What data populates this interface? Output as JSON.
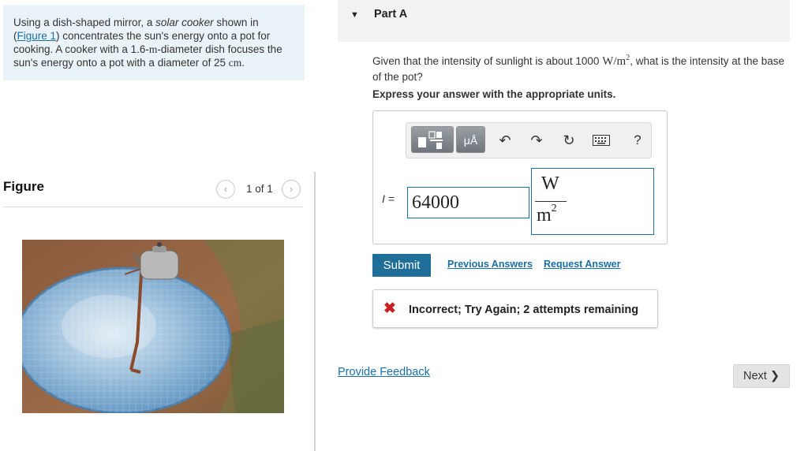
{
  "problem": {
    "text_1": "Using a dish-shaped mirror, a ",
    "italic": "solar cooker",
    "text_2": " shown in (",
    "figure_link": "Figure 1",
    "text_3": ") concentrates the sun's energy onto a pot for cooking. A cooker with a 1.6-",
    "unit_m": "m",
    "text_4": "-diameter dish focuses the sun's energy onto a pot with a diameter of 25 ",
    "unit_cm": "cm",
    "text_5": "."
  },
  "figure": {
    "title": "Figure",
    "count": "1 of 1",
    "prev_glyph": "‹",
    "next_glyph": "›"
  },
  "part": {
    "caret": "▼",
    "title": "Part A"
  },
  "question": {
    "text_1": "Given that the intensity of sunlight is about 1000 ",
    "unit": "W/m",
    "unit_exp": "2",
    "text_2": ", what is the intensity at the base of the pot?"
  },
  "instruction": "Express your answer with the appropriate units.",
  "toolbar": {
    "units_label": "μÅ",
    "undo_glyph": "↶",
    "redo_glyph": "↷",
    "reset_glyph": "↻",
    "help_glyph": "?"
  },
  "answer": {
    "variable": "I =",
    "value": "64000",
    "unit_numerator": "W",
    "unit_denominator": "m",
    "unit_exponent": "2"
  },
  "actions": {
    "submit": "Submit",
    "previous_answers": "Previous Answers",
    "request_answer": "Request Answer"
  },
  "feedback": {
    "icon": "✖",
    "message": "Incorrect; Try Again; 2 attempts remaining"
  },
  "footer": {
    "provide_feedback": "Provide Feedback",
    "next": "Next ❯"
  },
  "colors": {
    "accent": "#1f6e99",
    "link": "#1a6fa8",
    "error": "#cc1f1f",
    "problem_bg": "#eaf4f8"
  }
}
